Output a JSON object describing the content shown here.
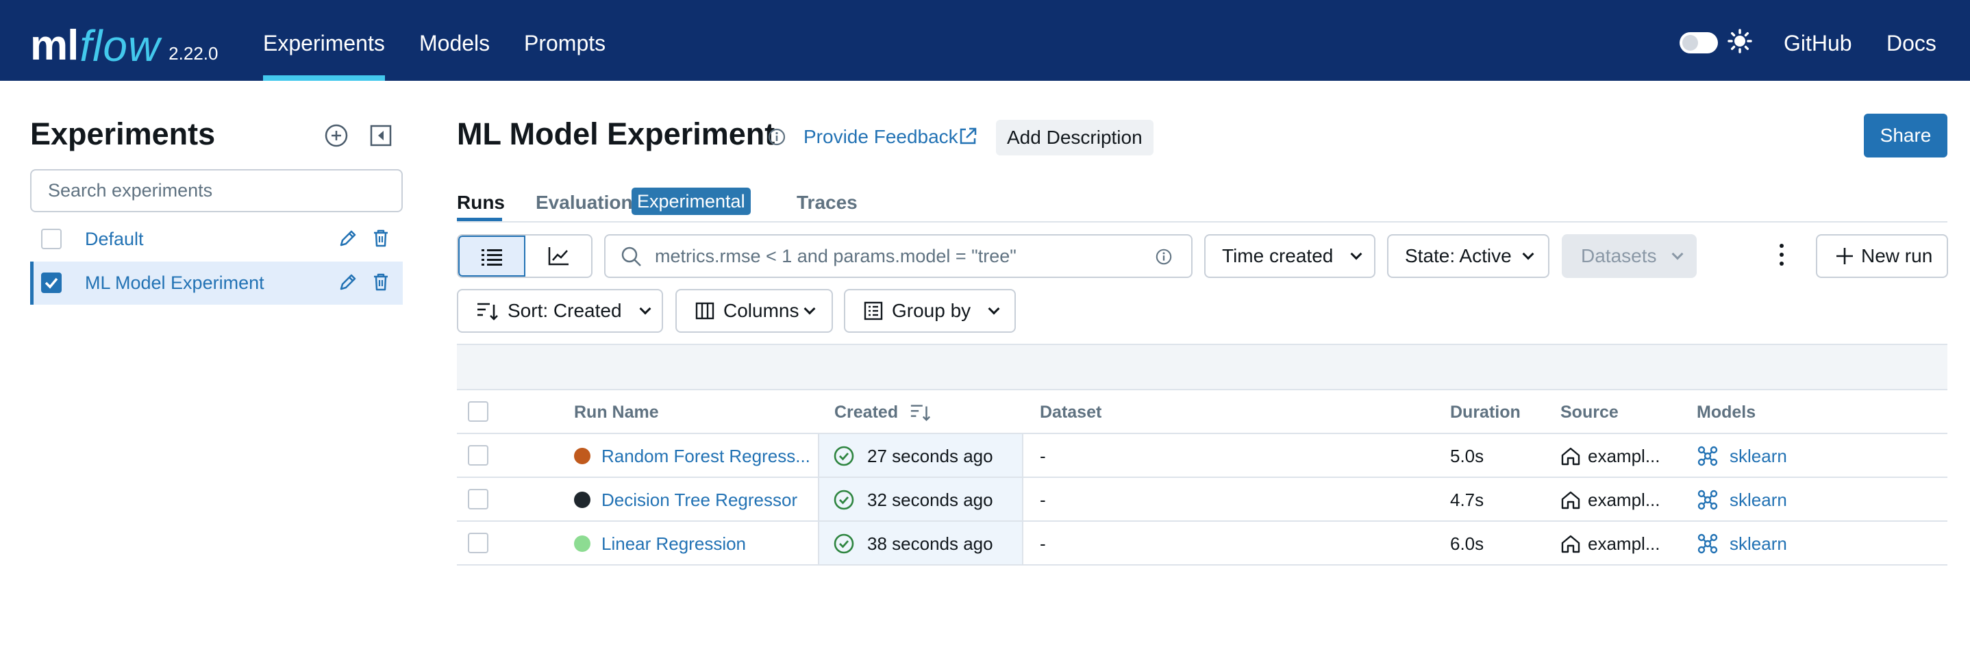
{
  "brand": {
    "logo_ml": "ml",
    "logo_flow": "flow",
    "version": "2.22.0"
  },
  "nav": {
    "links": [
      {
        "label": "Experiments",
        "active": true
      },
      {
        "label": "Models"
      },
      {
        "label": "Prompts"
      }
    ],
    "github": "GitHub",
    "docs": "Docs",
    "theme_toggle_on": false
  },
  "sidebar": {
    "title": "Experiments",
    "search_placeholder": "Search experiments",
    "experiments": [
      {
        "name": "Default",
        "checked": false
      },
      {
        "name": "ML Model Experiment",
        "checked": true
      }
    ]
  },
  "header": {
    "title": "ML Model Experiment",
    "feedback": "Provide Feedback",
    "add_description": "Add Description",
    "share": "Share"
  },
  "tabs": {
    "runs": "Runs",
    "evaluation": "Evaluation",
    "experimental_badge": "Experimental",
    "traces": "Traces"
  },
  "toolbar": {
    "filter_value": "metrics.rmse < 1 and params.model = \"tree\"",
    "time_created": "Time created",
    "state": "State: Active",
    "datasets": "Datasets",
    "new_run": "New run",
    "sort": "Sort: Created",
    "columns": "Columns",
    "group_by": "Group by"
  },
  "table": {
    "columns": {
      "run_name": "Run Name",
      "created": "Created",
      "dataset": "Dataset",
      "duration": "Duration",
      "source": "Source",
      "models": "Models"
    },
    "rows": [
      {
        "color": "#c05a1d",
        "run_name": "Random Forest Regress...",
        "created": "27 seconds ago",
        "dataset": "-",
        "duration": "5.0s",
        "source": "exampl...",
        "model": "sklearn"
      },
      {
        "color": "#1f272d",
        "run_name": "Decision Tree Regressor",
        "created": "32 seconds ago",
        "dataset": "-",
        "duration": "4.7s",
        "source": "exampl...",
        "model": "sklearn"
      },
      {
        "color": "#8ddc92",
        "run_name": "Linear Regression",
        "created": "38 seconds ago",
        "dataset": "-",
        "duration": "6.0s",
        "source": "exampl...",
        "model": "sklearn"
      }
    ]
  },
  "colors": {
    "nav_bg": "#0e2f6d",
    "accent": "#43c9ed",
    "primary": "#2272b4",
    "success": "#2e8540"
  }
}
